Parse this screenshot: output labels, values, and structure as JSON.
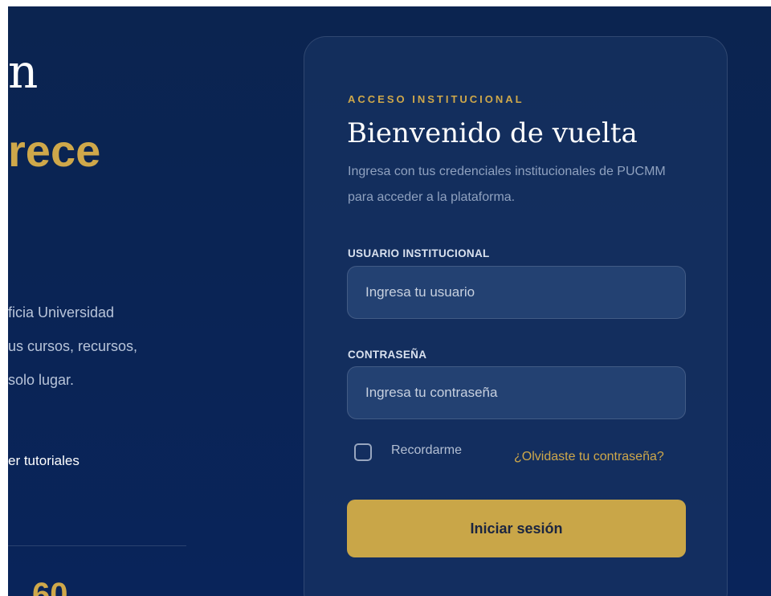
{
  "hero": {
    "title_line1_fragment": "n",
    "title_line2_fragment": "rece",
    "description_lines": [
      "ficia Universidad",
      "us cursos, recursos,",
      "solo lugar."
    ],
    "link_fragment": "er tutoriales",
    "stat_fragment": "60"
  },
  "login": {
    "eyebrow": "ACCESO INSTITUCIONAL",
    "title": "Bienvenido de vuelta",
    "subtitle": "Ingresa con tus credenciales institucionales de PUCMM para acceder a la plataforma.",
    "username_label": "USUARIO INSTITUCIONAL",
    "username_placeholder": "Ingresa tu usuario",
    "username_value": "",
    "password_label": "CONTRASEÑA",
    "password_placeholder": "Ingresa tu contraseña",
    "password_value": "",
    "remember_label": "Recordarme",
    "remember_checked": false,
    "forgot_link": "¿Olvidaste tu contraseña?",
    "submit_label": "Iniciar sesión"
  },
  "colors": {
    "background": "#0a2454",
    "accent_gold": "#cfa84a",
    "button_gold": "#c9a648",
    "text_muted": "#8fa1bf"
  },
  "icons": {
    "remember_checkbox": "empty-checkbox-icon"
  }
}
